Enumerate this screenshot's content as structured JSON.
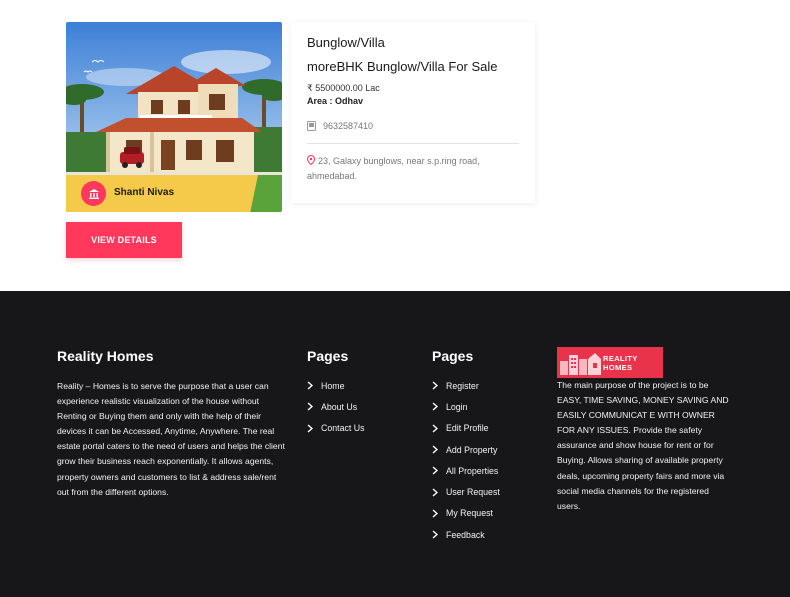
{
  "listing": {
    "owner_name": "Shanti Nivas",
    "property_type": "Bunglow/Villa",
    "title": "moreBHK Bunglow/Villa For Sale",
    "price": "₹ 5500000.00 Lac",
    "area": "Area : Odhav",
    "phone": "9632587410",
    "address": "23, Galaxy bunglows, near s.p.ring road, ahmedabad.",
    "view_button": "VIEW DETAILS",
    "icons": [
      "bank-icon",
      "phone-icon",
      "location-pin-icon"
    ]
  },
  "footer": {
    "about": {
      "heading": "Reality Homes",
      "text": "Reality – Homes is to serve the purpose that a user can experience realistic visualization of the house without Renting or Buying them and only with the help of their devices it can be Accessed, Anytime, Anywhere. The real estate portal caters to the need of users and helps the client grow their business reach exponentially. It allows agents, property owners and customers to list & address sale/rent out from the different options."
    },
    "pages1": {
      "heading": "Pages",
      "links": [
        "Home",
        "About Us",
        "Contact Us"
      ]
    },
    "pages2": {
      "heading": "Pages",
      "links": [
        "Register",
        "Login",
        "Edit Profile",
        "Add Property",
        "All Properties",
        "User Request",
        "My Request",
        "Feedback"
      ]
    },
    "brand": {
      "logo_line1": "REALITY",
      "logo_line2": "HOMES",
      "text": "The main purpose of the project is to be EASY, TIME SAVING, MONEY SAVING AND EASILY COMMUNICAT E WITH OWNER FOR ANY ISSUES. Provide the safety assurance and show house for rent or for Buying. Allows sharing of available property deals, upcoming property fairs and more via social media channels for the registered users."
    }
  },
  "colors": {
    "accent": "#ff385c",
    "owner_tag": "#f5c94a",
    "footer_bg": "#17171a",
    "logo_bg": "#e8334a"
  }
}
